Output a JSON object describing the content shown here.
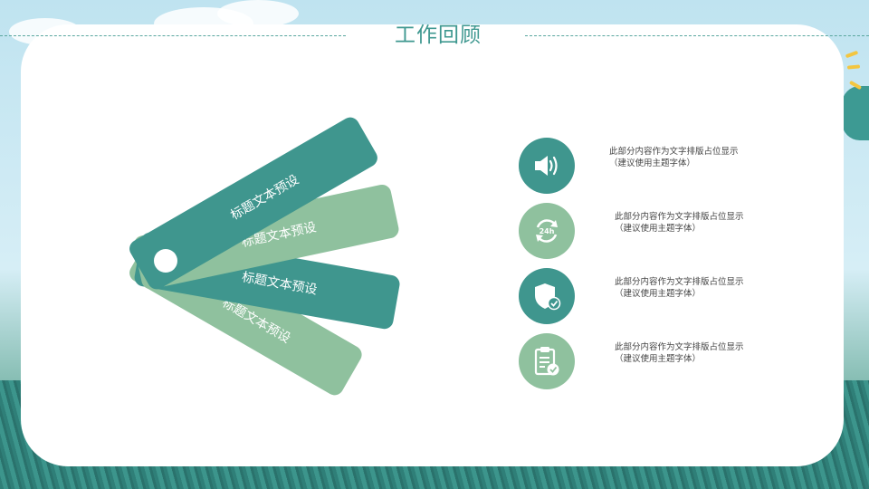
{
  "header": {
    "title": "工作回顾"
  },
  "fan_labels": [
    "标题文本预设",
    "标题文本预设",
    "标题文本预设",
    "标题文本预设"
  ],
  "items": [
    {
      "icon": "speaker-icon",
      "line1": "此部分内容作为文字排版占位显示",
      "line2": "（建议使用主题字体）"
    },
    {
      "icon": "24h-refresh-icon",
      "badge": "24h",
      "line1": "此部分内容作为文字排版占位显示",
      "line2": "（建议使用主题字体）"
    },
    {
      "icon": "shield-check-icon",
      "line1": "此部分内容作为文字排版占位显示",
      "line2": "（建议使用主题字体）"
    },
    {
      "icon": "clipboard-check-icon",
      "line1": "此部分内容作为文字排版占位显示",
      "line2": "（建议使用主题字体）"
    }
  ],
  "colors": {
    "dark": "#3f968e",
    "light": "#8fc19e",
    "title": "#3f9890"
  }
}
